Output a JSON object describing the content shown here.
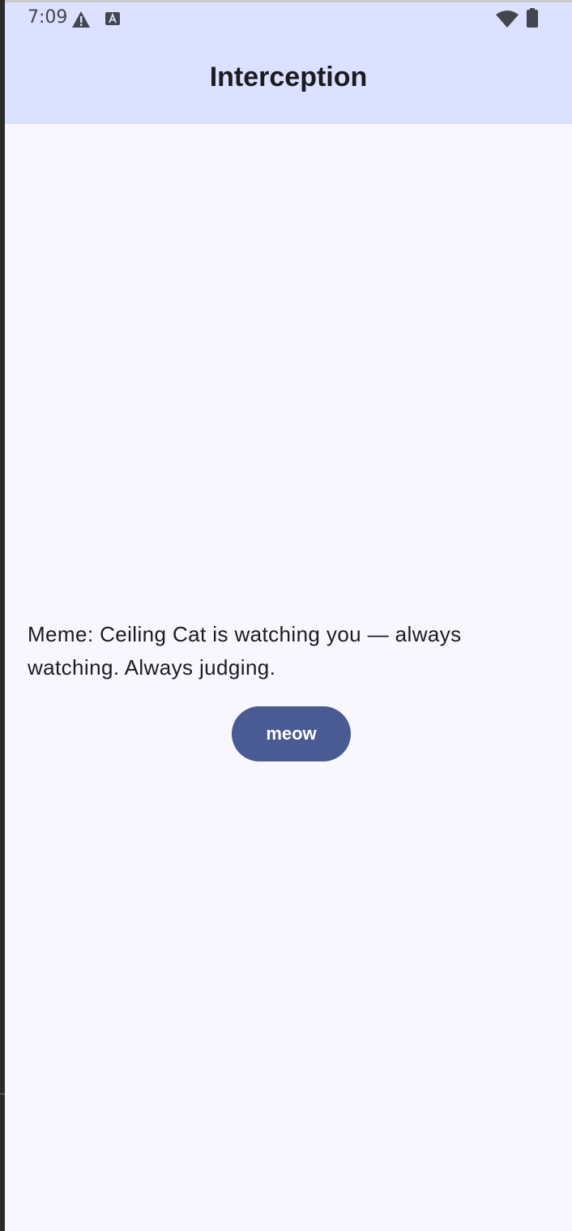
{
  "status_bar": {
    "time": "7:09",
    "icons": [
      "warning-icon",
      "a-icon",
      "wifi-icon",
      "battery-icon"
    ]
  },
  "app_bar": {
    "title": "Interception"
  },
  "content": {
    "meme_text": "Meme: Ceiling Cat is watching you — always watching. Always judging.",
    "button_label": "meow"
  },
  "colors": {
    "app_bar_bg": "#dbe1fe",
    "page_bg": "#f8f7fd",
    "button_bg": "#4a5a92",
    "text": "#1b1b21"
  }
}
